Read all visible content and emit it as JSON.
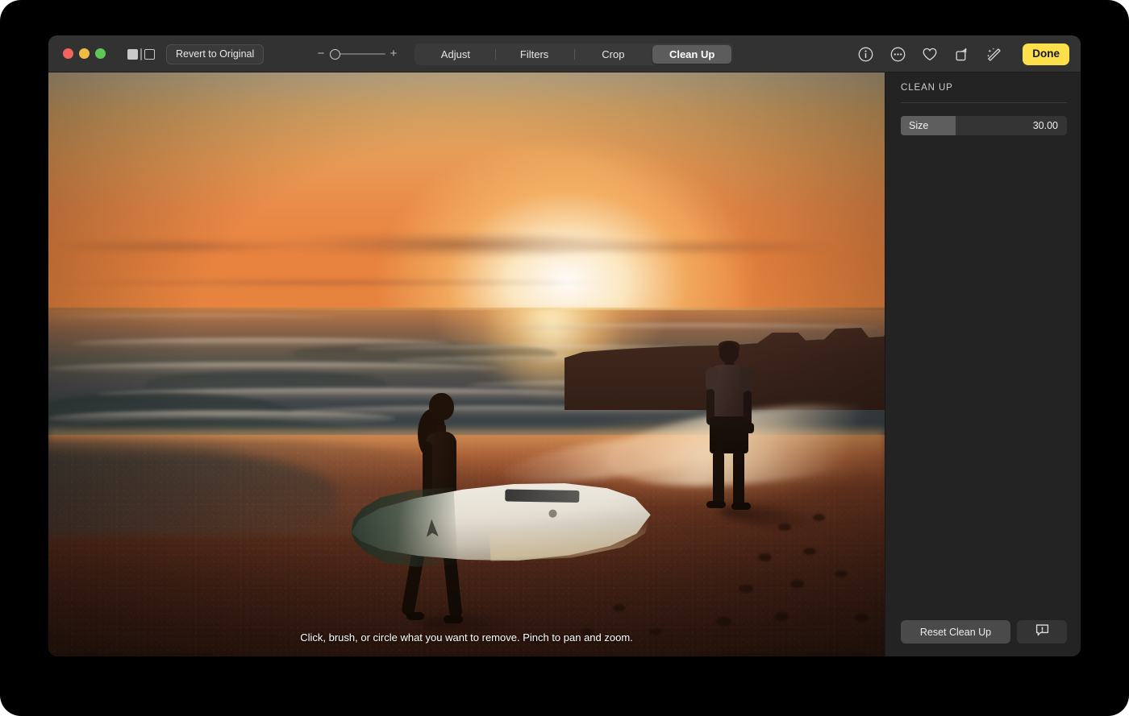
{
  "window": {
    "traffic_lights": [
      "close",
      "minimize",
      "maximize"
    ],
    "compare_toggle_name": "compare-before-after"
  },
  "toolbar": {
    "revert_label": "Revert to Original",
    "zoom": {
      "minus": "−",
      "plus": "+",
      "level_percent": 0
    },
    "tabs": [
      {
        "label": "Adjust",
        "active": false
      },
      {
        "label": "Filters",
        "active": false
      },
      {
        "label": "Crop",
        "active": false
      },
      {
        "label": "Clean Up",
        "active": true
      }
    ],
    "icons": [
      {
        "name": "info-icon",
        "glyph": "i"
      },
      {
        "name": "more-options-icon",
        "glyph": "⋯"
      },
      {
        "name": "favorite-heart-icon",
        "glyph": "♡"
      },
      {
        "name": "rotate-icon",
        "glyph": "↻"
      },
      {
        "name": "magic-wand-icon",
        "glyph": "✨"
      }
    ],
    "done_label": "Done"
  },
  "canvas": {
    "caption": "Click, brush, or circle what you want to remove. Pinch to pan and zoom."
  },
  "panel": {
    "title": "CLEAN UP",
    "size_slider": {
      "label": "Size",
      "value": "30.00",
      "fill_percent": 33
    },
    "reset_label": "Reset Clean Up",
    "feedback_icon_name": "feedback-bubble-icon"
  },
  "colors": {
    "accent_done": "#fbe04b",
    "toolbar_bg": "#323232",
    "panel_bg": "#232323",
    "window_bg": "#2b2b2b",
    "backdrop": "#000000",
    "traffic_close": "#f2645c",
    "traffic_min": "#f2bb46",
    "traffic_max": "#5fc758"
  }
}
